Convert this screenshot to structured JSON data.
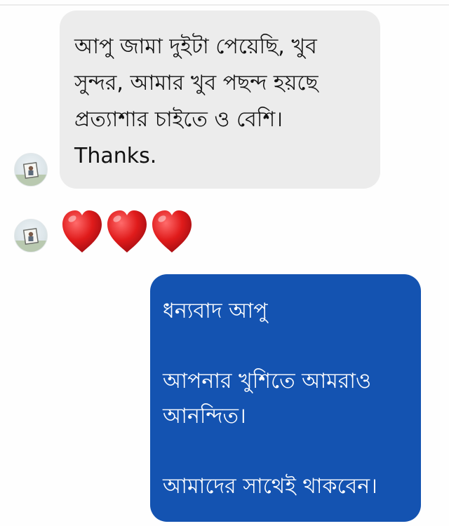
{
  "conversation": {
    "incoming": {
      "lines": [
        "আপু জামা দুইটা পেয়েছি, খুব",
        "সুন্দর, আমার খুব পছন্দ হয়ছে",
        "প্রত্যাশার চাইতে ও বেশি।",
        "Thanks."
      ]
    },
    "reaction": {
      "emoji": "❤️❤️❤️",
      "icon": "heart-icon",
      "count": 3,
      "color": "#e01b1b"
    },
    "outgoing": {
      "color": "#1453b1",
      "line1": "ধন্যবাদ আপু",
      "line2": "আপনার খুশিতে আমরাও",
      "line3": "আনন্দিত।",
      "line4": "আমাদের সাথেই থাকবেন।"
    }
  }
}
